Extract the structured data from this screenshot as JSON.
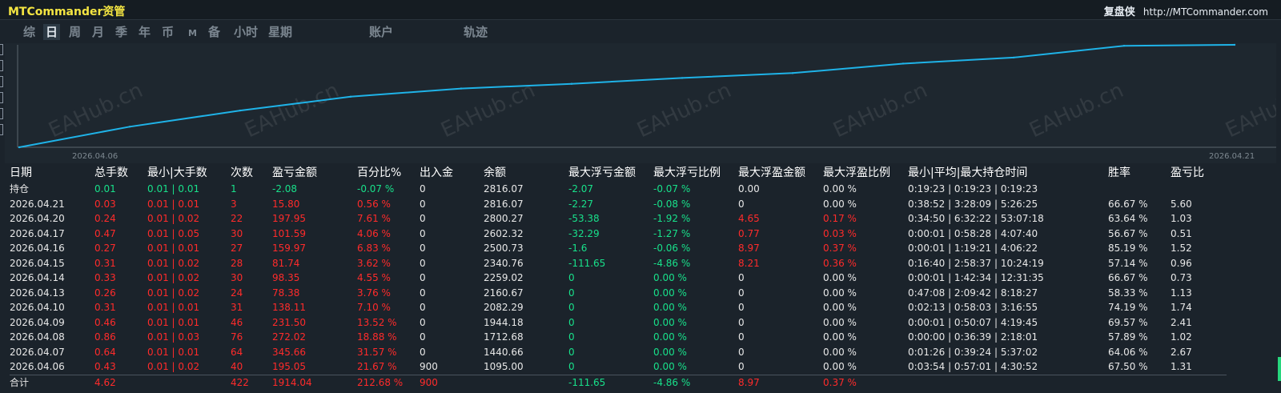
{
  "header": {
    "app_title": "MTCommander资管",
    "brand_cn": "复盘侠",
    "brand_url": "http://MTCommander.com"
  },
  "tabs": [
    {
      "label": "综",
      "active": false
    },
    {
      "label": "日",
      "active": true
    },
    {
      "label": "周",
      "active": false
    },
    {
      "label": "月",
      "active": false
    },
    {
      "label": "季",
      "active": false
    },
    {
      "label": "年",
      "active": false
    },
    {
      "label": "币",
      "active": false
    },
    {
      "label": "M",
      "active": false
    },
    {
      "label": "备",
      "active": false
    },
    {
      "label": "小时",
      "active": false
    },
    {
      "label": "星期",
      "active": false
    },
    {
      "label": "账户",
      "active": false
    },
    {
      "label": "轨迹",
      "active": false
    }
  ],
  "watermark": "EAHub.cn",
  "chart_data": {
    "type": "line",
    "x_start_label": "2026.04.06",
    "x_end_label": "2026.04.21",
    "x": [
      "2026.04.06",
      "2026.04.07",
      "2026.04.08",
      "2026.04.09",
      "2026.04.10",
      "2026.04.13",
      "2026.04.14",
      "2026.04.15",
      "2026.04.16",
      "2026.04.17",
      "2026.04.20",
      "2026.04.21"
    ],
    "series": [
      {
        "values": [
          1095.0,
          1440.66,
          1712.68,
          1944.18,
          2082.29,
          2160.67,
          2259.02,
          2340.76,
          2500.73,
          2602.32,
          2800.27,
          2816.07
        ],
        "color": "#1fb3e8"
      }
    ]
  },
  "colors": {
    "positive": "#ff2b2b",
    "negative": "#18e08a",
    "line": "#1fb3e8"
  },
  "table": {
    "headers": [
      "日期",
      "总手数",
      "最小|大手数",
      "次数",
      "盈亏金额",
      "百分比%",
      "出入金",
      "余额",
      "最大浮亏金额",
      "最大浮亏比例",
      "最大浮盈金额",
      "最大浮盈比例",
      "最小|平均|最大持仓时间",
      "胜率",
      "盈亏比"
    ],
    "holding": [
      "持仓",
      "0.01",
      "0.01 | 0.01",
      "1",
      "-2.08",
      "-0.07 %",
      "0",
      "2816.07",
      "-2.07",
      "-0.07 %",
      "0.00",
      "0.00 %",
      "0:19:23 | 0:19:23 | 0:19:23",
      "",
      ""
    ],
    "rows": [
      [
        "2026.04.21",
        "0.03",
        "0.01 | 0.01",
        "3",
        "15.80",
        "0.56 %",
        "0",
        "2816.07",
        "-2.27",
        "-0.08 %",
        "0",
        "0.00 %",
        "0:38:52 | 3:28:09 | 5:26:25",
        "66.67 %",
        "5.60"
      ],
      [
        "2026.04.20",
        "0.24",
        "0.01 | 0.02",
        "22",
        "197.95",
        "7.61 %",
        "0",
        "2800.27",
        "-53.38",
        "-1.92 %",
        "4.65",
        "0.17 %",
        "0:34:50 | 6:32:22 | 53:07:18",
        "63.64 %",
        "1.03"
      ],
      [
        "2026.04.17",
        "0.47",
        "0.01 | 0.05",
        "30",
        "101.59",
        "4.06 %",
        "0",
        "2602.32",
        "-32.29",
        "-1.27 %",
        "0.77",
        "0.03 %",
        "0:00:01 | 0:58:28 | 4:07:40",
        "56.67 %",
        "0.51"
      ],
      [
        "2026.04.16",
        "0.27",
        "0.01 | 0.01",
        "27",
        "159.97",
        "6.83 %",
        "0",
        "2500.73",
        "-1.6",
        "-0.06 %",
        "8.97",
        "0.37 %",
        "0:00:01 | 1:19:21 | 4:06:22",
        "85.19 %",
        "1.52"
      ],
      [
        "2026.04.15",
        "0.31",
        "0.01 | 0.02",
        "28",
        "81.74",
        "3.62 %",
        "0",
        "2340.76",
        "-111.65",
        "-4.86 %",
        "8.21",
        "0.36 %",
        "0:16:40 | 2:58:37 | 10:24:19",
        "57.14 %",
        "0.96"
      ],
      [
        "2026.04.14",
        "0.33",
        "0.01 | 0.02",
        "30",
        "98.35",
        "4.55 %",
        "0",
        "2259.02",
        "0",
        "0.00 %",
        "0",
        "0.00 %",
        "0:00:01 | 1:42:34 | 12:31:35",
        "66.67 %",
        "0.73"
      ],
      [
        "2026.04.13",
        "0.26",
        "0.01 | 0.02",
        "24",
        "78.38",
        "3.76 %",
        "0",
        "2160.67",
        "0",
        "0.00 %",
        "0",
        "0.00 %",
        "0:47:08 | 2:09:42 | 8:18:27",
        "58.33 %",
        "1.13"
      ],
      [
        "2026.04.10",
        "0.31",
        "0.01 | 0.01",
        "31",
        "138.11",
        "7.10 %",
        "0",
        "2082.29",
        "0",
        "0.00 %",
        "0",
        "0.00 %",
        "0:02:13 | 0:58:03 | 3:16:55",
        "74.19 %",
        "1.74"
      ],
      [
        "2026.04.09",
        "0.46",
        "0.01 | 0.01",
        "46",
        "231.50",
        "13.52 %",
        "0",
        "1944.18",
        "0",
        "0.00 %",
        "0",
        "0.00 %",
        "0:00:01 | 0:50:07 | 4:19:45",
        "69.57 %",
        "2.41"
      ],
      [
        "2026.04.08",
        "0.86",
        "0.01 | 0.03",
        "76",
        "272.02",
        "18.88 %",
        "0",
        "1712.68",
        "0",
        "0.00 %",
        "0",
        "0.00 %",
        "0:00:00 | 0:36:39 | 2:18:01",
        "57.89 %",
        "1.02"
      ],
      [
        "2026.04.07",
        "0.64",
        "0.01 | 0.01",
        "64",
        "345.66",
        "31.57 %",
        "0",
        "1440.66",
        "0",
        "0.00 %",
        "0",
        "0.00 %",
        "0:01:26 | 0:39:24 | 5:37:02",
        "64.06 %",
        "2.67"
      ],
      [
        "2026.04.06",
        "0.43",
        "0.01 | 0.02",
        "40",
        "195.05",
        "21.67 %",
        "900",
        "1095.00",
        "0",
        "0.00 %",
        "0",
        "0.00 %",
        "0:03:54 | 0:57:01 | 4:30:52",
        "67.50 %",
        "1.31"
      ]
    ],
    "total": [
      "合计",
      "4.62",
      "",
      "422",
      "1914.04",
      "212.68 %",
      "900",
      "",
      "-111.65",
      "-4.86 %",
      "8.97",
      "0.37 %",
      "",
      "",
      ""
    ]
  }
}
